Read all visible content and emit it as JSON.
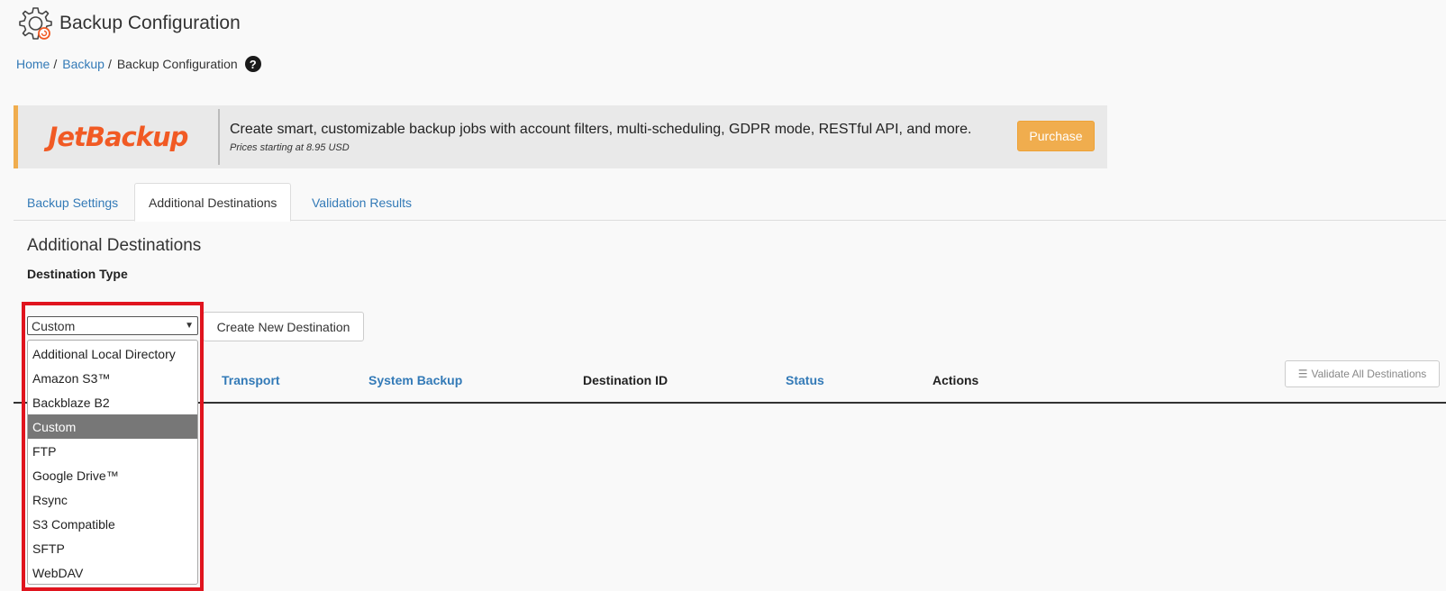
{
  "header": {
    "title": "Backup Configuration",
    "icon": "gear-icon"
  },
  "breadcrumb": {
    "home": "Home",
    "sep": "/",
    "backup": "Backup",
    "current": "Backup Configuration"
  },
  "promo": {
    "logo_text": "JetBackup",
    "text": "Create smart, customizable backup jobs with account filters, multi-scheduling, GDPR mode, RESTful API, and more.",
    "subtext": "Prices starting at 8.95 USD",
    "purchase_label": "Purchase",
    "accent_color": "#f0ad4e"
  },
  "tabs": [
    {
      "label": "Backup Settings",
      "active": false
    },
    {
      "label": "Additional Destinations",
      "active": true
    },
    {
      "label": "Validation Results",
      "active": false
    }
  ],
  "section": {
    "title": "Additional Destinations",
    "field_label": "Destination Type"
  },
  "destination_select": {
    "selected": "Custom",
    "options": [
      "Additional Local Directory",
      "Amazon S3™",
      "Backblaze B2",
      "Custom",
      "FTP",
      "Google Drive™",
      "Rsync",
      "S3 Compatible",
      "SFTP",
      "WebDAV"
    ]
  },
  "create_button": "Create New Destination",
  "table": {
    "columns": [
      "Transport",
      "System Backup",
      "Destination ID",
      "Status",
      "Actions"
    ],
    "validate_button": "Validate All Destinations"
  },
  "colors": {
    "link": "#337ab7",
    "highlight": "#e0141e",
    "selected_option": "#777777"
  }
}
